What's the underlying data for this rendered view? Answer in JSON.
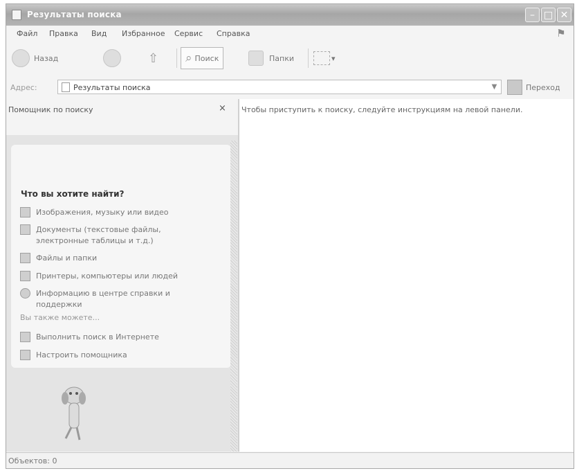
{
  "window": {
    "title": "Результаты поиска",
    "minimize_glyph": "–",
    "maximize_glyph": "□",
    "close_glyph": "✕"
  },
  "menu": [
    "Файл",
    "Правка",
    "Вид",
    "Избранное",
    "Сервис",
    "Справка"
  ],
  "toolbar": {
    "back_label": "Назад",
    "search_label": "Поиск",
    "folders_label": "Папки",
    "views_arrow": "▾"
  },
  "address": {
    "label": "Адрес:",
    "value": "Результаты поиска",
    "go_label": "Переход"
  },
  "search_pane": {
    "title": "Помощник по поиску",
    "close_glyph": "×",
    "question": "Что вы хотите найти?",
    "options": [
      {
        "label": "Изображения, музыку или видео",
        "icon": "media-icon"
      },
      {
        "label": "Документы (текстовые файлы, электронные таблицы и т.д.)",
        "icon": "document-icon"
      },
      {
        "label": "Файлы и папки",
        "icon": "folder-icon"
      },
      {
        "label": "Принтеры, компьютеры или людей",
        "icon": "computer-icon"
      },
      {
        "label": "Информацию в центре справки и поддержки",
        "icon": "help-icon"
      }
    ],
    "also_label": "Вы также можете...",
    "extra_options": [
      {
        "label": "Выполнить поиск в Интернете",
        "icon": "internet-search-icon"
      },
      {
        "label": "Настроить помощника",
        "icon": "settings-icon"
      }
    ]
  },
  "results": {
    "hint": "Чтобы приступить к поиску, следуйте инструкциям на левой панели."
  },
  "status": {
    "text": "Объектов: 0"
  }
}
